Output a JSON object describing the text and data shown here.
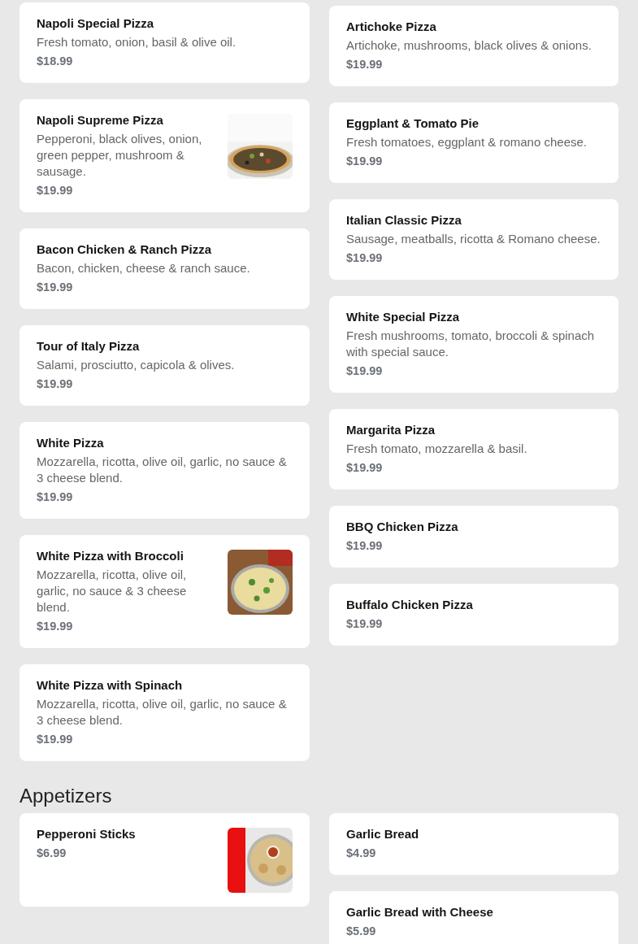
{
  "sections": [
    {
      "columns": [
        [
          {
            "name": "Napoli Special Pizza",
            "description": "Fresh tomato, onion, basil & olive oil.",
            "price": "$18.99"
          },
          {
            "name": "Napoli Supreme Pizza",
            "description": "Pepperoni, black olives, onion, green pepper, mushroom & sausage.",
            "price": "$19.99"
          },
          {
            "name": "Bacon Chicken & Ranch Pizza",
            "description": "Bacon, chicken, cheese & ranch sauce.",
            "price": "$19.99"
          },
          {
            "name": "Tour of Italy Pizza",
            "description": "Salami, prosciutto, capicola & olives.",
            "price": "$19.99"
          },
          {
            "name": "White Pizza",
            "description": "Mozzarella, ricotta, olive oil, garlic, no sauce & 3 cheese blend.",
            "price": "$19.99"
          },
          {
            "name": "White Pizza with Broccoli",
            "description": "Mozzarella, ricotta, olive oil, garlic, no sauce & 3 cheese blend.",
            "price": "$19.99"
          },
          {
            "name": "White Pizza with Spinach",
            "description": "Mozzarella, ricotta, olive oil, garlic, no sauce & 3 cheese blend.",
            "price": "$19.99"
          }
        ],
        [
          {
            "name": "Artichoke Pizza",
            "description": "Artichoke, mushrooms, black olives & onions.",
            "price": "$19.99"
          },
          {
            "name": "Eggplant & Tomato Pie",
            "description": "Fresh tomatoes, eggplant & romano cheese.",
            "price": "$19.99"
          },
          {
            "name": "Italian Classic Pizza",
            "description": "Sausage, meatballs, ricotta & Romano cheese.",
            "price": "$19.99"
          },
          {
            "name": "White Special Pizza",
            "description": "Fresh mushrooms, tomato, broccoli & spinach with special sauce.",
            "price": "$19.99"
          },
          {
            "name": "Margarita Pizza",
            "description": "Fresh tomato, mozzarella & basil.",
            "price": "$19.99"
          },
          {
            "name": "BBQ Chicken Pizza",
            "price": "$19.99"
          },
          {
            "name": "Buffalo Chicken Pizza",
            "price": "$19.99"
          }
        ]
      ]
    },
    {
      "heading": "Appetizers",
      "columns": [
        [
          {
            "name": "Pepperoni Sticks",
            "price": "$6.99"
          }
        ],
        [
          {
            "name": "Garlic Bread",
            "price": "$4.99"
          },
          {
            "name": "Garlic Bread with Cheese",
            "price": "$5.99"
          }
        ]
      ]
    }
  ]
}
